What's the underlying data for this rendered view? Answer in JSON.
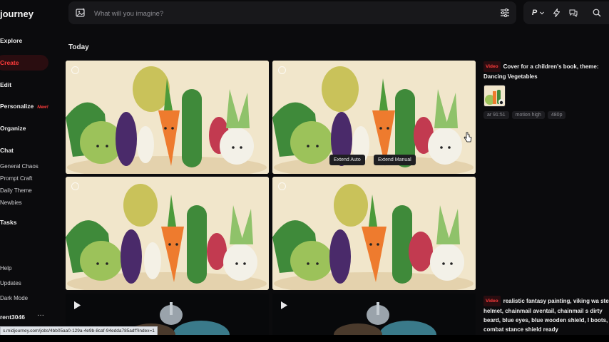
{
  "sidebar": {
    "logo": "journey",
    "items": [
      {
        "label": "Explore"
      },
      {
        "label": "Create"
      },
      {
        "label": "Edit"
      },
      {
        "label": "Personalize",
        "badge": "New!"
      },
      {
        "label": "Organize"
      },
      {
        "label": "Chat"
      }
    ],
    "chat_rooms": [
      "General Chaos",
      "Prompt Craft",
      "Daily Theme",
      "Newbies"
    ],
    "tasks": "Tasks",
    "footer": [
      "Help",
      "Updates",
      "Dark Mode"
    ],
    "username": "rent3046",
    "user_menu": "···"
  },
  "search": {
    "placeholder": "What will you imagine?",
    "value": ""
  },
  "top_right": {
    "profile_letter": "P"
  },
  "section_title": "Today",
  "tiles": {
    "extend_auto": "Extend Auto",
    "extend_manual": "Extend Manual"
  },
  "job1": {
    "badge": "Video",
    "prompt": "Cover for a children's book, theme: Dancing Vegetables",
    "tags": [
      "ar 91:51",
      "motion high",
      "480p"
    ]
  },
  "job2": {
    "badge": "Video",
    "prompt": "realistic fantasy painting, viking wa steel helmet, chainmail aventail, chainmail s dirty beard, blue eyes, blue wooden shield, l boots, combat stance shield ready"
  },
  "status_url": "s.midjourney.com/jobs/4bb05aa0-129a-4e9b-8caf-94edda785adf?index=1",
  "colors": {
    "accent": "#ff3b3b",
    "background": "#0b0b0d",
    "panel": "#18181b"
  }
}
